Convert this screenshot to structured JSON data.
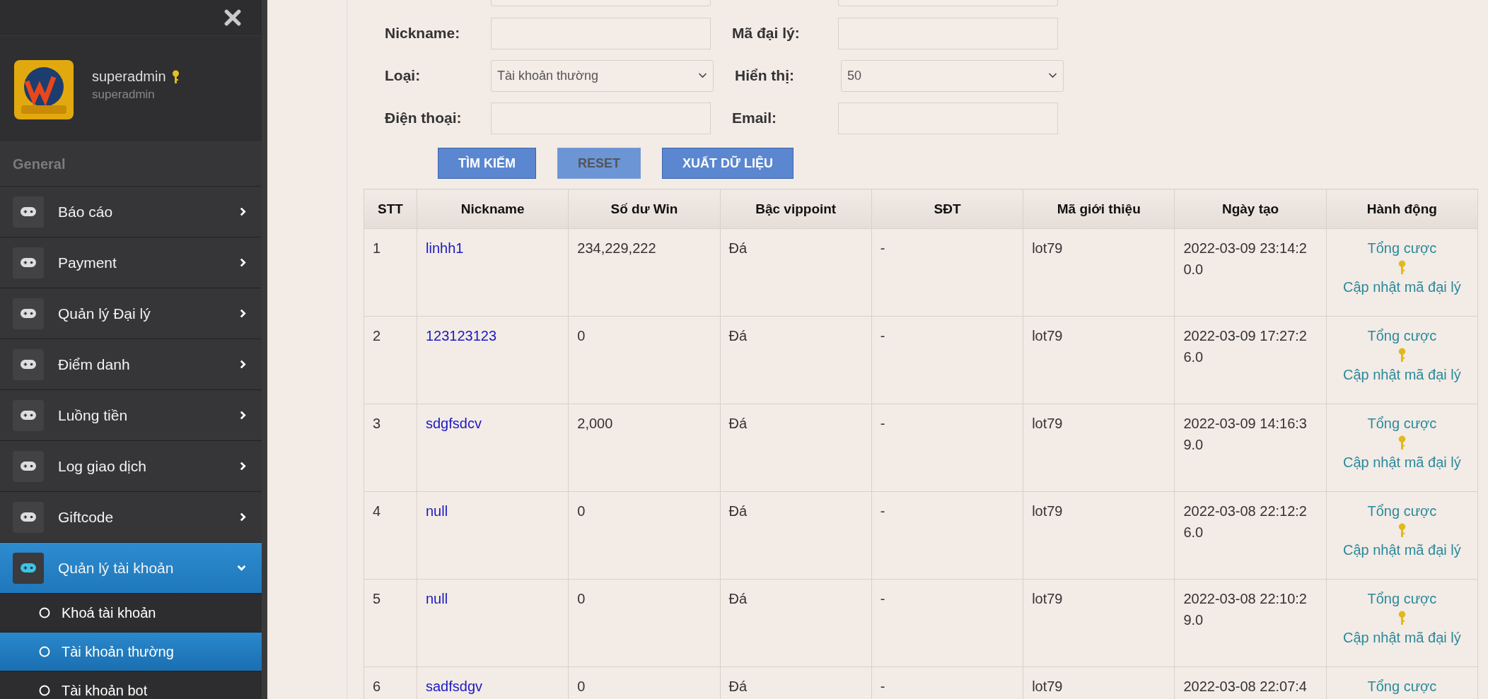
{
  "sidebar": {
    "user": {
      "name": "superadmin",
      "role": "superadmin"
    },
    "section": "General",
    "items": [
      {
        "label": "Báo cáo",
        "selected": false,
        "expanded": false
      },
      {
        "label": "Payment",
        "selected": false,
        "expanded": false
      },
      {
        "label": "Quản lý Đại lý",
        "selected": false,
        "expanded": false
      },
      {
        "label": "Điểm danh",
        "selected": false,
        "expanded": false
      },
      {
        "label": "Luồng tiền",
        "selected": false,
        "expanded": false
      },
      {
        "label": "Log giao dịch",
        "selected": false,
        "expanded": false
      },
      {
        "label": "Giftcode",
        "selected": false,
        "expanded": false
      },
      {
        "label": "Quản lý tài khoản",
        "selected": true,
        "expanded": true,
        "children": [
          {
            "label": "Khoá tài khoản",
            "selected": false
          },
          {
            "label": "Tài khoản thường",
            "selected": true
          },
          {
            "label": "Tài khoản bot",
            "selected": false
          }
        ]
      }
    ]
  },
  "filters": [
    [
      {
        "label": "Nickname:",
        "kind": "input"
      },
      {
        "label": "Mã đại lý:",
        "kind": "input"
      }
    ],
    [
      {
        "label": "Loại:",
        "kind": "select",
        "value": "Tài khoản thường"
      },
      {
        "label": "Hiển thị:",
        "kind": "select",
        "value": "50"
      }
    ],
    [
      {
        "label": "Điện thoại:",
        "kind": "input"
      },
      {
        "label": "Email:",
        "kind": "input"
      }
    ]
  ],
  "buttons": [
    {
      "label": "TÌM KIẾM",
      "kind": "primary"
    },
    {
      "label": "RESET",
      "kind": "muted"
    },
    {
      "label": "XUẤT DỮ LIỆU",
      "kind": "primary"
    }
  ],
  "table": {
    "columns": [
      "STT",
      "Nickname",
      "Số dư Win",
      "Bậc vippoint",
      "SĐT",
      "Mã giới thiệu",
      "Ngày tạo",
      "Hành động"
    ],
    "rows": [
      {
        "stt": "1",
        "nickname": "linhh1",
        "balance": "234,229,222",
        "vip": "Đá",
        "phone": "-",
        "ref": "lot79",
        "created": "2022-03-09 23:14:20.0",
        "actions": [
          "Tổng cược",
          "Cập nhật mã đại lý"
        ]
      },
      {
        "stt": "2",
        "nickname": "123123123",
        "balance": "0",
        "vip": "Đá",
        "phone": "-",
        "ref": "lot79",
        "created": "2022-03-09 17:27:26.0",
        "actions": [
          "Tổng cược",
          "Cập nhật mã đại lý"
        ]
      },
      {
        "stt": "3",
        "nickname": "sdgfsdcv",
        "balance": "2,000",
        "vip": "Đá",
        "phone": "-",
        "ref": "lot79",
        "created": "2022-03-09 14:16:39.0",
        "actions": [
          "Tổng cược",
          "Cập nhật mã đại lý"
        ]
      },
      {
        "stt": "4",
        "nickname": "null",
        "balance": "0",
        "vip": "Đá",
        "phone": "-",
        "ref": "lot79",
        "created": "2022-03-08 22:12:26.0",
        "actions": [
          "Tổng cược",
          "Cập nhật mã đại lý"
        ]
      },
      {
        "stt": "5",
        "nickname": "null",
        "balance": "0",
        "vip": "Đá",
        "phone": "-",
        "ref": "lot79",
        "created": "2022-03-08 22:10:29.0",
        "actions": [
          "Tổng cược",
          "Cập nhật mã đại lý"
        ]
      },
      {
        "stt": "6",
        "nickname": "sadfsdgv",
        "balance": "0",
        "vip": "Đá",
        "phone": "-",
        "ref": "lot79",
        "created": "2022-03-08 22:07:4",
        "actions": [
          "Tổng cược"
        ]
      }
    ]
  }
}
